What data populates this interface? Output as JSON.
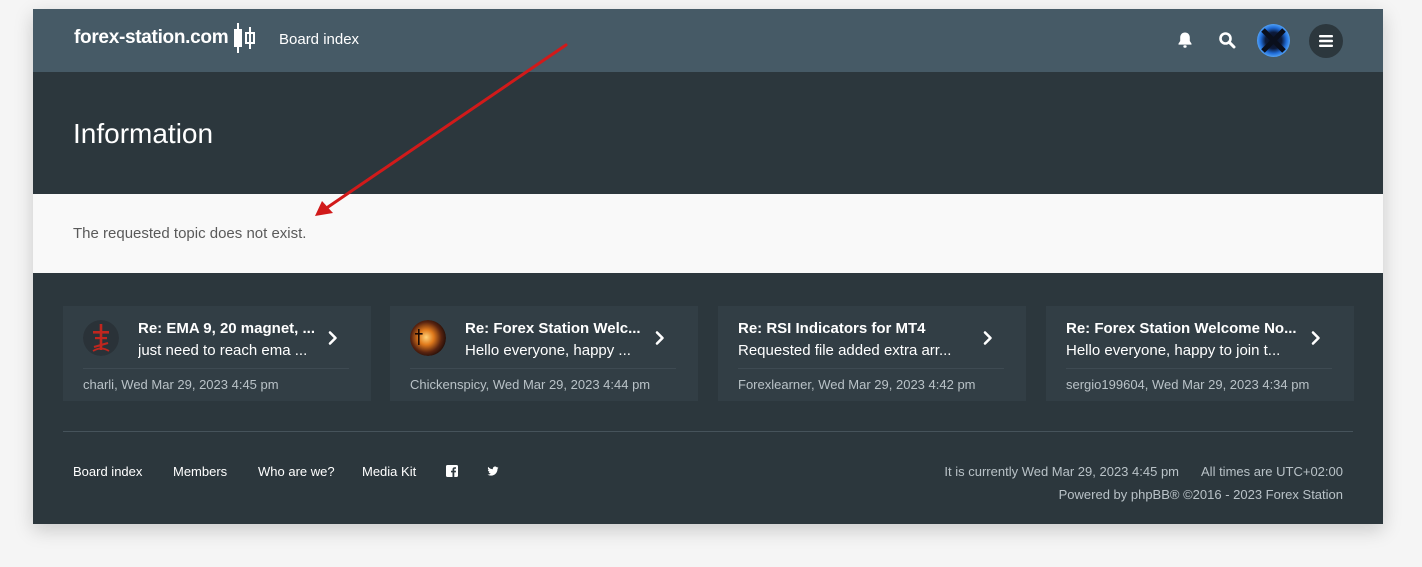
{
  "header": {
    "logo_text": "forex-station.com",
    "nav_link": "Board index",
    "icons": [
      "bell-icon",
      "search-icon",
      "user-avatar",
      "hamburger-menu-icon"
    ]
  },
  "page": {
    "title": "Information",
    "message": "The requested topic does not exist."
  },
  "recent_posts": [
    {
      "title": "Re: EMA 9, 20 magnet, ...",
      "excerpt": "just need to reach ema ...",
      "author": "charli",
      "time": "Wed Mar 29, 2023 4:45 pm",
      "meta": "charli, Wed Mar 29, 2023 4:45 pm",
      "avatar": "cross-avatar"
    },
    {
      "title": "Re: Forex Station Welc...",
      "excerpt": "Hello everyone, happy ...",
      "author": "Chickenspicy",
      "time": "Wed Mar 29, 2023 4:44 pm",
      "meta": "Chickenspicy, Wed Mar 29, 2023 4:44 pm",
      "avatar": "sunset-avatar"
    },
    {
      "title": "Re: RSI Indicators for MT4",
      "excerpt": "Requested file added extra arr...",
      "author": "Forexlearner",
      "time": "Wed Mar 29, 2023 4:42 pm",
      "meta": "Forexlearner, Wed Mar 29, 2023 4:42 pm",
      "avatar": null
    },
    {
      "title": "Re: Forex Station Welcome No...",
      "excerpt": "Hello everyone, happy to join t...",
      "author": "sergio199604",
      "time": "Wed Mar 29, 2023 4:34 pm",
      "meta": "sergio199604, Wed Mar 29, 2023 4:34 pm",
      "avatar": null
    }
  ],
  "footer": {
    "links": [
      "Board index",
      "Members",
      "Who are we?",
      "Media Kit"
    ],
    "social_icons": [
      "facebook-icon",
      "twitter-icon"
    ],
    "current_time": "It is currently Wed Mar 29, 2023 4:45 pm",
    "timezone": "All times are UTC+02:00",
    "powered_by": "Powered by phpBB® ©2016 - 2023 Forex Station"
  },
  "colors": {
    "header_bg": "#465a66",
    "page_bg": "#2c373d",
    "card_bg": "#323e45",
    "message_bg": "#f9f9f9",
    "annotation_arrow": "#d11a1a"
  }
}
